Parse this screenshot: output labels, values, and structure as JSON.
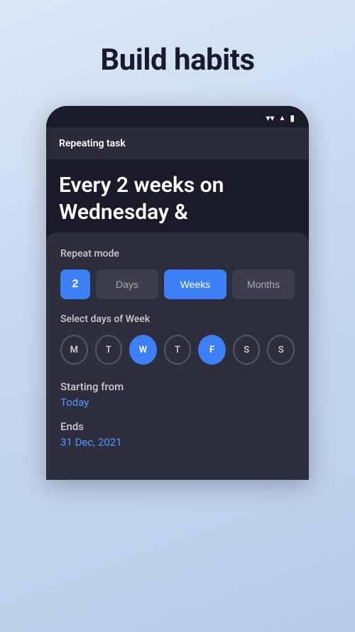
{
  "page": {
    "title": "Build habits"
  },
  "phone": {
    "status_bar": {
      "wifi": "wifi",
      "signal": "signal",
      "battery": "battery"
    },
    "header": {
      "title": "Repeating task"
    },
    "content": {
      "main_text": "Every 2 weeks on Wednesday &"
    }
  },
  "bottom_sheet": {
    "repeat_mode_label": "Repeat mode",
    "number_value": "2",
    "buttons": [
      {
        "label": "Days",
        "state": "inactive"
      },
      {
        "label": "Weeks",
        "state": "active"
      },
      {
        "label": "Months",
        "state": "inactive"
      }
    ],
    "days_of_week_label": "Select days of Week",
    "days": [
      {
        "label": "M",
        "active": false
      },
      {
        "label": "T",
        "active": false
      },
      {
        "label": "W",
        "active": true
      },
      {
        "label": "T",
        "active": false
      },
      {
        "label": "F",
        "active": true
      },
      {
        "label": "S",
        "active": false
      },
      {
        "label": "S",
        "active": false
      }
    ],
    "starting_from_label": "Starting from",
    "starting_from_value": "Today",
    "ends_label": "Ends",
    "ends_value": "31 Dec, 2021"
  }
}
